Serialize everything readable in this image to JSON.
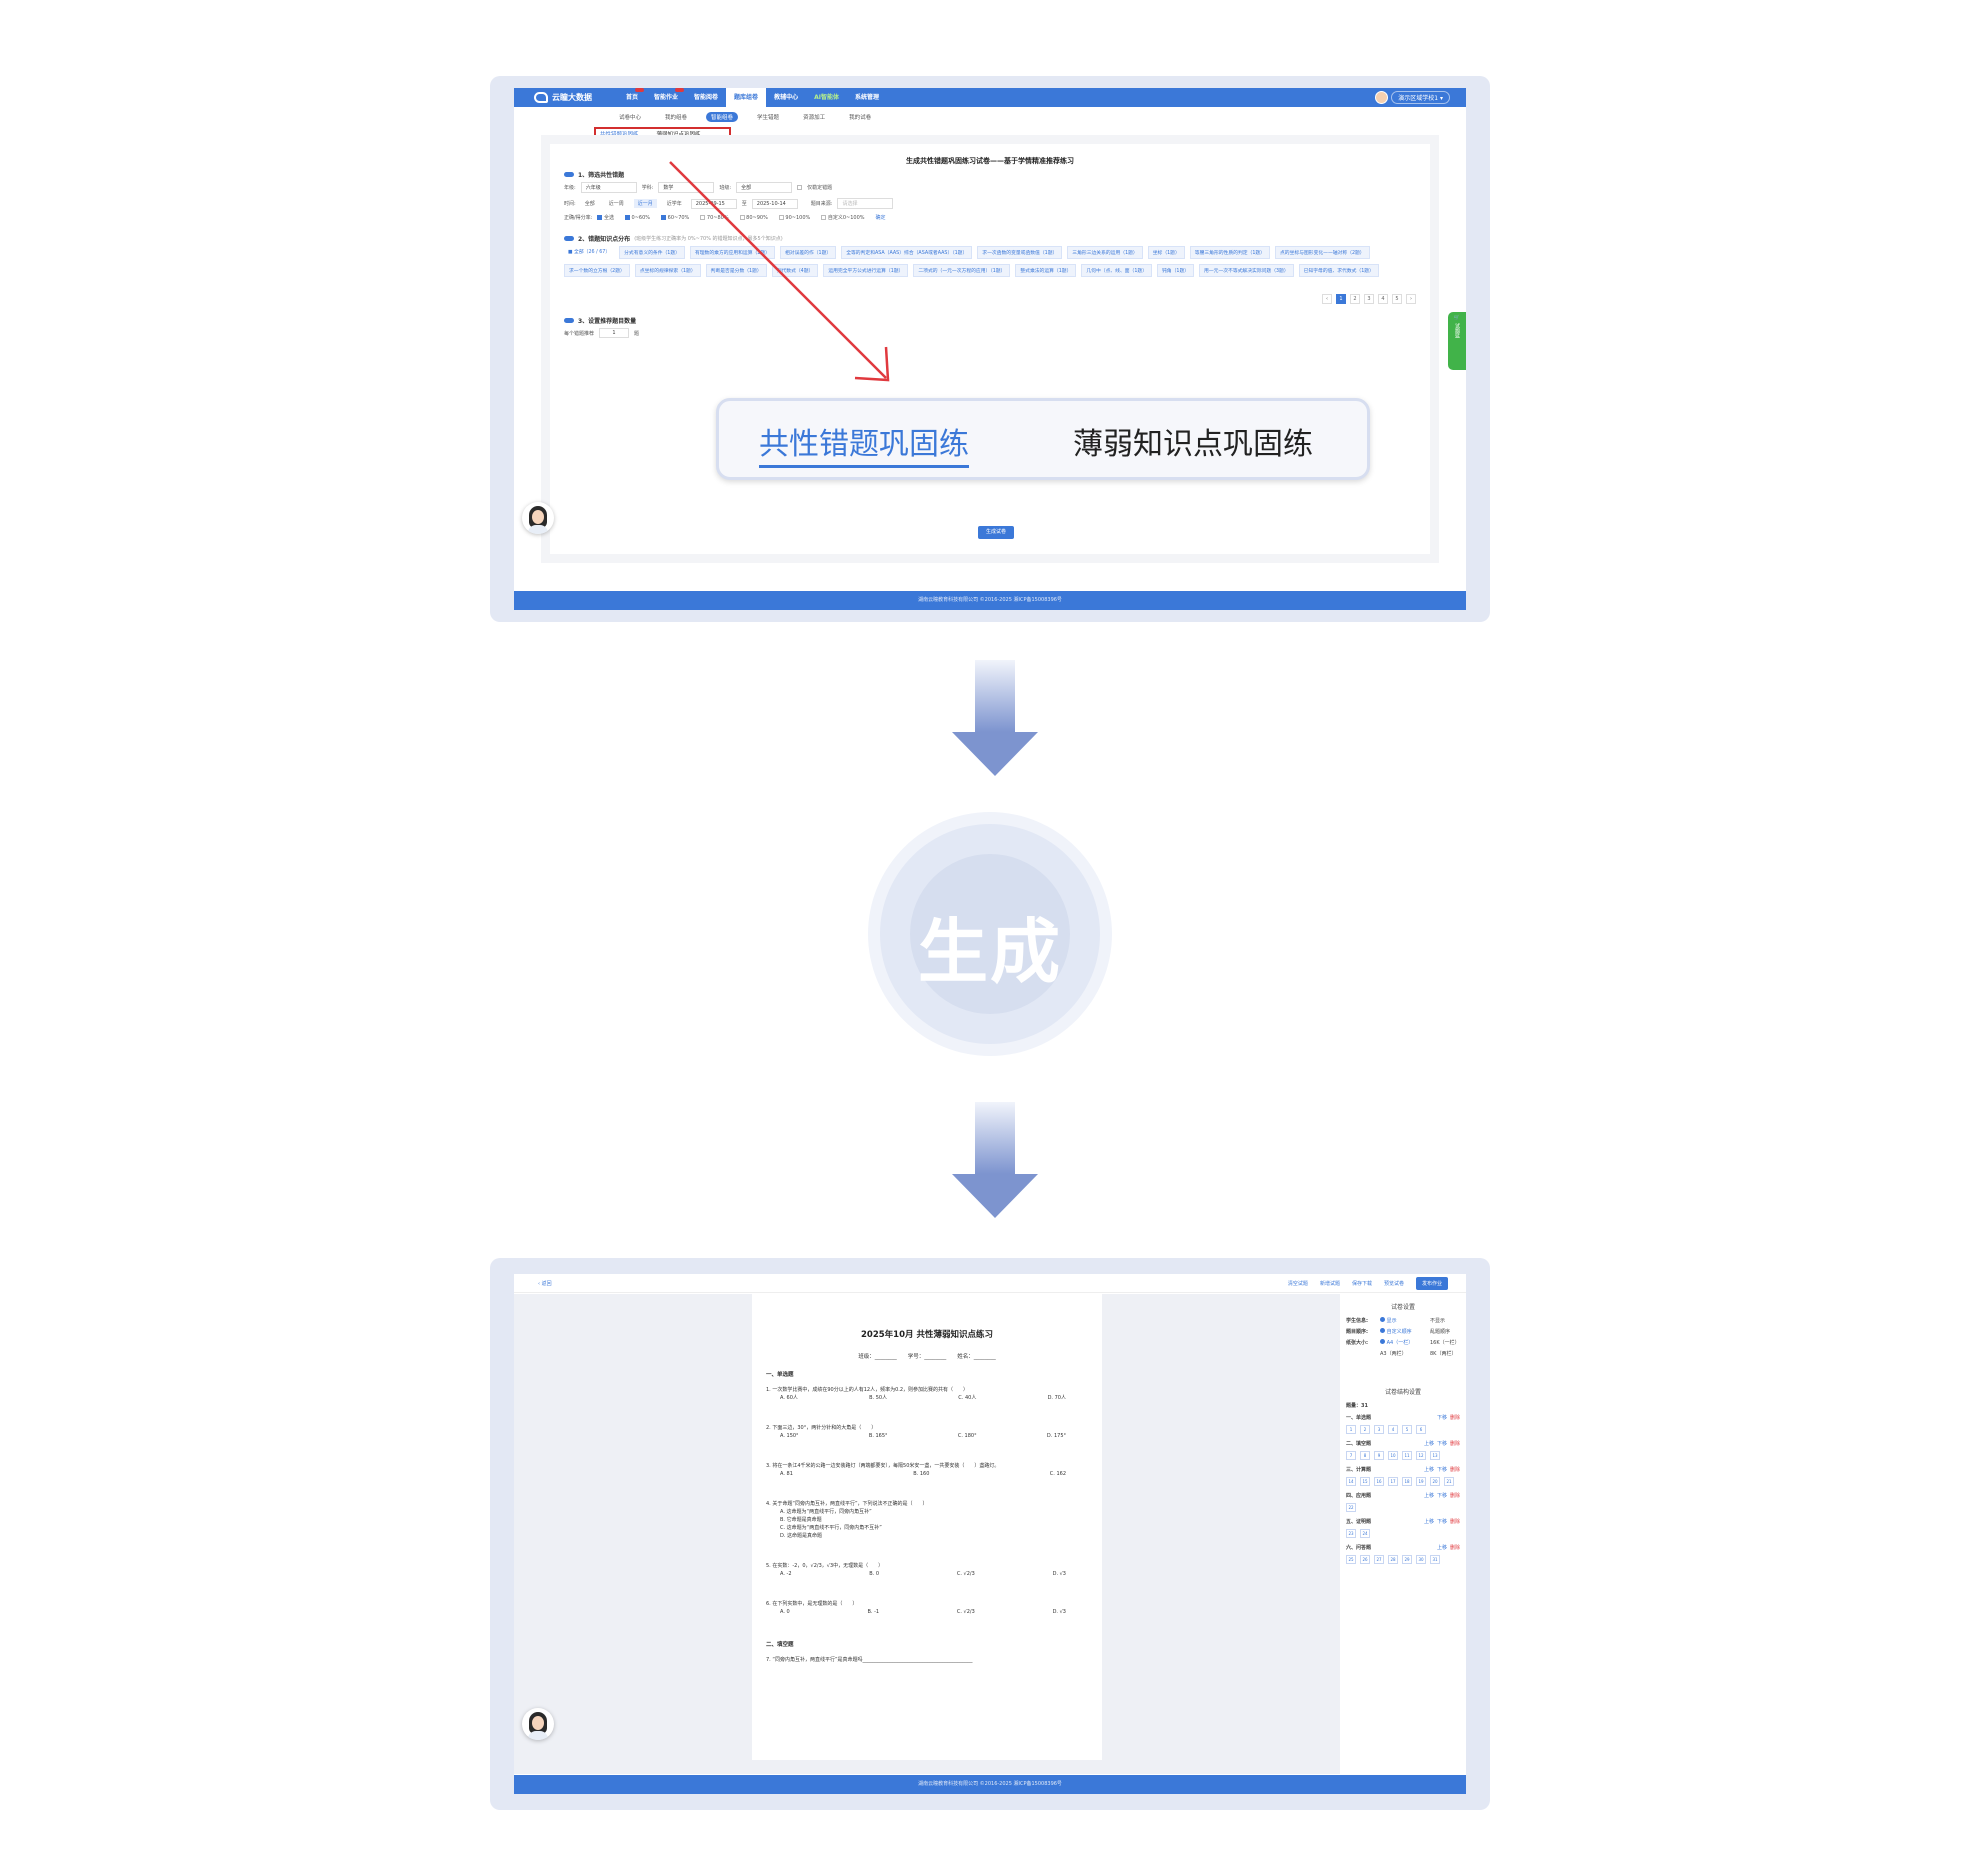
{
  "top_screen": {
    "brand": "云瞳大数据",
    "nav": [
      {
        "label": "首页",
        "badge": true
      },
      {
        "label": "智能作业",
        "badge": true
      },
      {
        "label": "智能阅卷",
        "badge": false
      },
      {
        "label": "题库组卷",
        "active": true
      },
      {
        "label": "教辅中心"
      },
      {
        "label": "AI智能体",
        "ai": true
      },
      {
        "label": "系统管理"
      }
    ],
    "user": "演示区域学校1",
    "subnav": [
      "试卷中心",
      "我的组卷",
      "智能组卷",
      "学生错题",
      "资源加工",
      "我的试卷"
    ],
    "subnav_active": 2,
    "tabs": [
      "共性错题巩固练",
      "薄弱知识点巩固练"
    ],
    "title": "生成共性错题巩固练习试卷——基于学情精准推荐练习",
    "section1": "1、筛选共性错题",
    "filters": {
      "grade_label": "年级:",
      "grade": "六年级",
      "subject_label": "学科:",
      "subject": "数学",
      "class_label": "班级:",
      "class": "全部",
      "only_label": "仅勒定错题",
      "time_label": "时间:",
      "time_options": [
        "全部",
        "近一周",
        "近一月",
        "近学年"
      ],
      "time_active": 2,
      "date_from": "2025-09-15",
      "date_to_label": "至",
      "date_to": "2025-10-14",
      "source_label": "题目来源:",
      "source": "请选择",
      "rate_label": "正确/得分率:",
      "rate_options": [
        "全选",
        "0~60%",
        "60~70%",
        "70~80%",
        "80~90%",
        "90~100%",
        "自定义0~100%",
        "确定"
      ]
    },
    "section2": "2、错题知识点分布",
    "section2_hint": "(班级学生练习正确率为 0%~70% 的错题知识点，最多5个知识点)",
    "chips": [
      "全部（26 / 67）",
      "分式有意义的条件（1题）",
      "有理数的乘方的应用和运算（2题）",
      "相对误差的作（1题）",
      "全等的判定和ASA（AAS）综合（ASA或者AAS）（1题）",
      "求一次函数的变量或函数值（1题）",
      "三角形三边关系的运用（1题）",
      "坐标（1题）",
      "等腰三角形的性质的判定（1题）",
      "点的坐标与图形变化——轴对称（2题）",
      "求一个数的立方根（2题）",
      "点坐标的规律探索（1题）",
      "判断是否是分数（1题）",
      "列代数式（4题）",
      "运用完全平方公式进行运算（1题）",
      "二项式的（一元一次方程的应用）（1题）",
      "整式乘法的运算（1题）",
      "几何中（点、线、面（1题）",
      "钝角（1题）",
      "用一元一次不等式解决实际问题（3题）",
      "已知字母的值、求代数式（1题）"
    ],
    "pages": [
      "‹",
      "1",
      "2",
      "3",
      "4",
      "5",
      "›"
    ],
    "section3": "3、设置推荐题目数量",
    "per_label": "每个错题推荐",
    "per_value": "1",
    "per_unit": "题",
    "generate_btn": "生成试卷",
    "side_tab": "试题篮",
    "footer": "湖南云瞳教育科技有限公司 ©2016-2025 湘ICP备15008396号"
  },
  "zoom_tabs": [
    "共性错题巩固练",
    "薄弱知识点巩固练"
  ],
  "center_label": "生成",
  "bottom_screen": {
    "back": "‹ 返回",
    "actions": [
      "清空试题",
      "新增试题",
      "保存下载",
      "预览试卷"
    ],
    "publish": "发布作业",
    "paper_title": "2025年10月 共性薄弱知识点练习",
    "info": "班级：________　　学号：________　　姓名：________",
    "sections": [
      {
        "title": "一、单选题",
        "questions": [
          {
            "no": "1.",
            "stem": "一次数学比赛中，成绩在90分以上的人有12人，频率为0.2，则参加比赛的共有（　　）",
            "options": [
              "A. 60人",
              "B. 50人",
              "C. 40人",
              "D. 70人"
            ]
          },
          {
            "no": "2.",
            "stem": "下面三边，30°，两针分针和的大角是（　　）",
            "options": [
              "A. 150°",
              "B. 165°",
              "C. 180°",
              "D. 175°"
            ]
          },
          {
            "no": "3.",
            "stem": "将在一条江4千米的公路一边安装路灯（两端都要安），每隔50米安一盏，一共要安装（　　）盏路灯。",
            "options": [
              "A. 81",
              "B. 160",
              "C. 162"
            ]
          },
          {
            "no": "4.",
            "stem": "关于命题“同旁内角互补，两直线平行”，下列说法不正确的是（　　）",
            "options_col": [
              "A. 这命题为“两直线平行，同旁内角互补”",
              "B. 它命题是真命题",
              "C. 这命题为“两直线不平行，同旁内角不互补”",
              "D. 这命题是真命题"
            ]
          },
          {
            "no": "5.",
            "stem": "在实数：-2，0，√2/3，√3中，无理数是（　　）",
            "options": [
              "A. -2",
              "B. 0",
              "C. √2/3",
              "D. √3"
            ]
          },
          {
            "no": "6.",
            "stem": "在下列实数中，是无理数的是（　　）",
            "options": [
              "A. 0",
              "B. -1",
              "C. √2/3",
              "D. √3"
            ]
          }
        ]
      },
      {
        "title": "二、填空题",
        "questions": [
          {
            "no": "7.",
            "stem": "“同旁内角互补，两直线平行”是真命题吗____________________________________________"
          }
        ]
      }
    ],
    "settings_title": "试卷设置",
    "settings": [
      {
        "label": "学生信息:",
        "opt1": "显示",
        "opt2": "不显示"
      },
      {
        "label": "题目顺序:",
        "opt1": "自定义顺序",
        "opt2": "乱题顺序"
      },
      {
        "label": "纸张大小:",
        "opt1": "A4（一栏）",
        "opt2": "16K（一栏）"
      },
      {
        "label": "",
        "opt1": "A3（两栏）",
        "opt2": "8K（两栏）"
      }
    ],
    "structure_title": "试卷结构设置",
    "total": "题量：31",
    "groups": [
      {
        "name": "一、单选题",
        "ops": [
          "下移",
          "删除"
        ],
        "nums": [
          "1",
          "2",
          "3",
          "4",
          "5",
          "6"
        ]
      },
      {
        "name": "二、填空题",
        "ops": [
          "上移",
          "下移",
          "删除"
        ],
        "nums": [
          "7",
          "8",
          "9",
          "10",
          "11",
          "12",
          "13"
        ]
      },
      {
        "name": "三、计算题",
        "ops": [
          "上移",
          "下移",
          "删除"
        ],
        "nums": [
          "14",
          "15",
          "16",
          "17",
          "18",
          "19",
          "20",
          "21"
        ]
      },
      {
        "name": "四、应用题",
        "ops": [
          "上移",
          "下移",
          "删除"
        ],
        "nums": [
          "22"
        ]
      },
      {
        "name": "五、证明题",
        "ops": [
          "上移",
          "下移",
          "删除"
        ],
        "nums": [
          "23",
          "24"
        ]
      },
      {
        "name": "六、问答题",
        "ops": [
          "上移",
          "删除"
        ],
        "nums": [
          "25",
          "26",
          "27",
          "28",
          "29",
          "30",
          "31"
        ]
      }
    ],
    "footer": "湖南云瞳教育科技有限公司 ©2016-2025 湘ICP备15008396号"
  },
  "colors": {
    "primary": "#3b78d8",
    "highlight": "#d32f2f",
    "arrow": "#8aa0d8",
    "green": "#41b349"
  }
}
